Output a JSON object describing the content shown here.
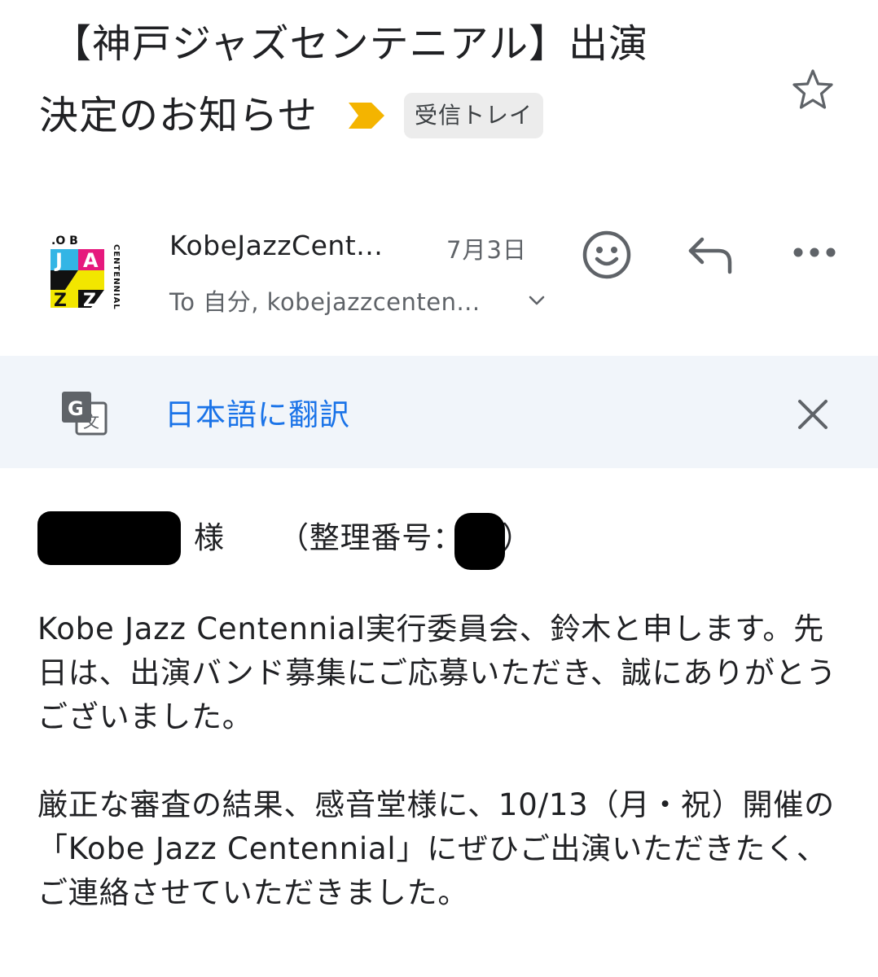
{
  "email": {
    "subject_line1": "【神戸ジャズセンテニアル】出演",
    "subject_line2": "決定のお知らせ",
    "label": "受信トレイ",
    "sender_name": "KobeJazzCent...",
    "date": "7月3日",
    "recipients": "To 自分, kobejazzcenten...",
    "translate_link": "日本語に翻訳"
  },
  "body": {
    "salutation_suffix": "様",
    "reference_label": "（整理番号：",
    "reference_close": "）",
    "paragraph1": "Kobe Jazz Centennial実行委員会、鈴木と申します。先日は、出演バンド募集にご応募いただき、誠にありがとうございました。",
    "paragraph2": "厳正な審査の結果、感音堂様に、10/13（月・祝）開催の「Kobe Jazz Centennial」にぜひご出演いただきたく、ご連絡させていただきました。"
  },
  "icons": {
    "star": "star-outline-icon",
    "important": "important-marker-icon",
    "emoji": "emoji-react-icon",
    "reply": "reply-icon",
    "more": "more-horizontal-icon",
    "translate": "translate-icon",
    "close": "close-icon",
    "chevron": "chevron-down-icon"
  },
  "colors": {
    "accent_link": "#1a73e8",
    "important_marker": "#f4b400",
    "translate_bar_bg": "#f1f5fa",
    "chip_bg": "#ececec"
  }
}
